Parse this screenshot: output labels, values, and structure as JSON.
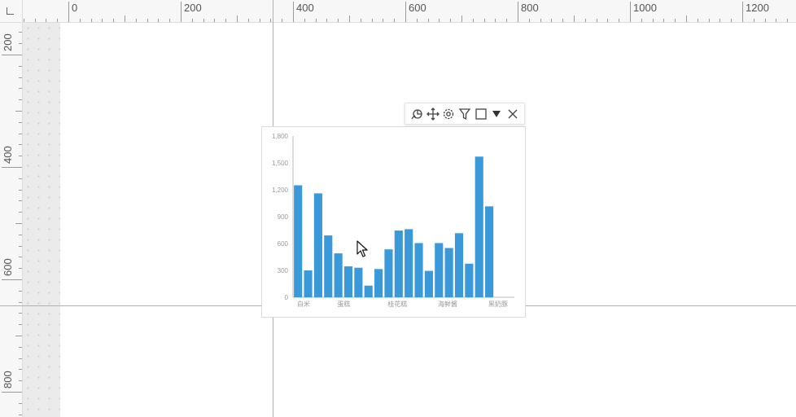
{
  "ruler": {
    "horizontal_labels": [
      "0",
      "200",
      "400",
      "600",
      "800",
      "1000",
      "1200"
    ],
    "vertical_labels": [
      "200",
      "400",
      "600",
      "800"
    ]
  },
  "colors": {
    "guide": "#f4a636",
    "bar": "#3a9ad9"
  },
  "toolbar": {
    "icons": [
      "chart-type-icon",
      "move-icon",
      "settings-icon",
      "filter-icon",
      "square-icon",
      "dropdown-triangle-icon",
      "close-icon"
    ]
  },
  "chart_data": {
    "type": "bar",
    "categories": [
      "白米",
      "",
      "",
      "",
      "蛋糕",
      "",
      "",
      "",
      "",
      "桂花糕",
      "",
      "",
      "",
      "",
      "海鲜酱",
      "",
      "",
      "",
      "",
      "黑奶豚",
      "",
      ""
    ],
    "values": [
      1250,
      300,
      1160,
      690,
      490,
      345,
      330,
      130,
      315,
      535,
      745,
      760,
      605,
      295,
      605,
      550,
      715,
      375,
      1570,
      1015,
      0,
      0
    ],
    "yticks": [
      "0",
      "300",
      "600",
      "900",
      "1,200",
      "1,500",
      "1,800"
    ],
    "ylim": [
      0,
      1800
    ],
    "xlabel": "",
    "ylabel": ""
  }
}
